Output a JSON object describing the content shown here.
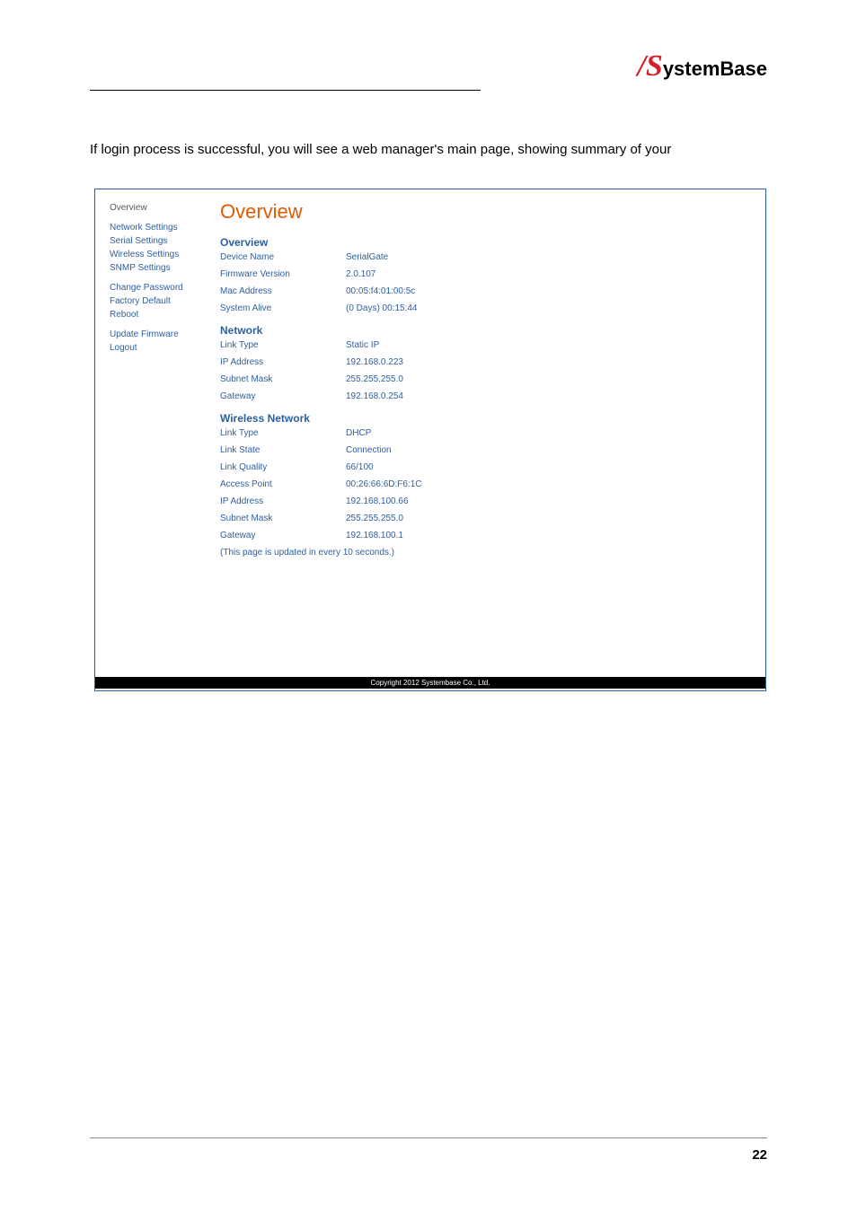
{
  "logo": {
    "slash": "/",
    "s": "S",
    "rest": "ystemBase"
  },
  "intro": "If login process is successful, you will see a web manager's main page, showing summary of your",
  "sidebar": {
    "g1": [
      "Overview"
    ],
    "g2": [
      "Network Settings",
      "Serial Settings",
      "Wireless Settings",
      "SNMP Settings"
    ],
    "g3": [
      "Change Password",
      "Factory Default",
      "Reboot"
    ],
    "g4": [
      "Update Firmware",
      "Logout"
    ]
  },
  "main_title": "Overview",
  "sections": {
    "overview": {
      "title": "Overview",
      "rows": [
        {
          "label": "Device Name",
          "value": "SerialGate"
        },
        {
          "label": "Firmware Version",
          "value": "2.0.107"
        },
        {
          "label": "Mac Address",
          "value": "00:05:f4:01:00:5c"
        },
        {
          "label": "System Alive",
          "value": "(0 Days) 00:15:44"
        }
      ]
    },
    "network": {
      "title": "Network",
      "rows": [
        {
          "label": "Link Type",
          "value": "Static IP"
        },
        {
          "label": "IP Address",
          "value": "192.168.0.223"
        },
        {
          "label": "Subnet Mask",
          "value": "255.255.255.0"
        },
        {
          "label": "Gateway",
          "value": "192.168.0.254"
        }
      ]
    },
    "wireless": {
      "title": "Wireless Network",
      "rows": [
        {
          "label": "Link Type",
          "value": "DHCP"
        },
        {
          "label": "Link State",
          "value": "Connection"
        },
        {
          "label": "Link Quality",
          "value": "66/100"
        },
        {
          "label": "Access Point",
          "value": "00:26:66:6D:F6:1C"
        },
        {
          "label": "IP Address",
          "value": "192.168.100.66"
        },
        {
          "label": "Subnet Mask",
          "value": "255.255.255.0"
        },
        {
          "label": "Gateway",
          "value": "192.168.100.1"
        }
      ]
    }
  },
  "note": "(This page is updated in every 10 seconds.)",
  "copyright": "Copyright 2012 Systembase Co., Ltd.",
  "page_num": "22"
}
